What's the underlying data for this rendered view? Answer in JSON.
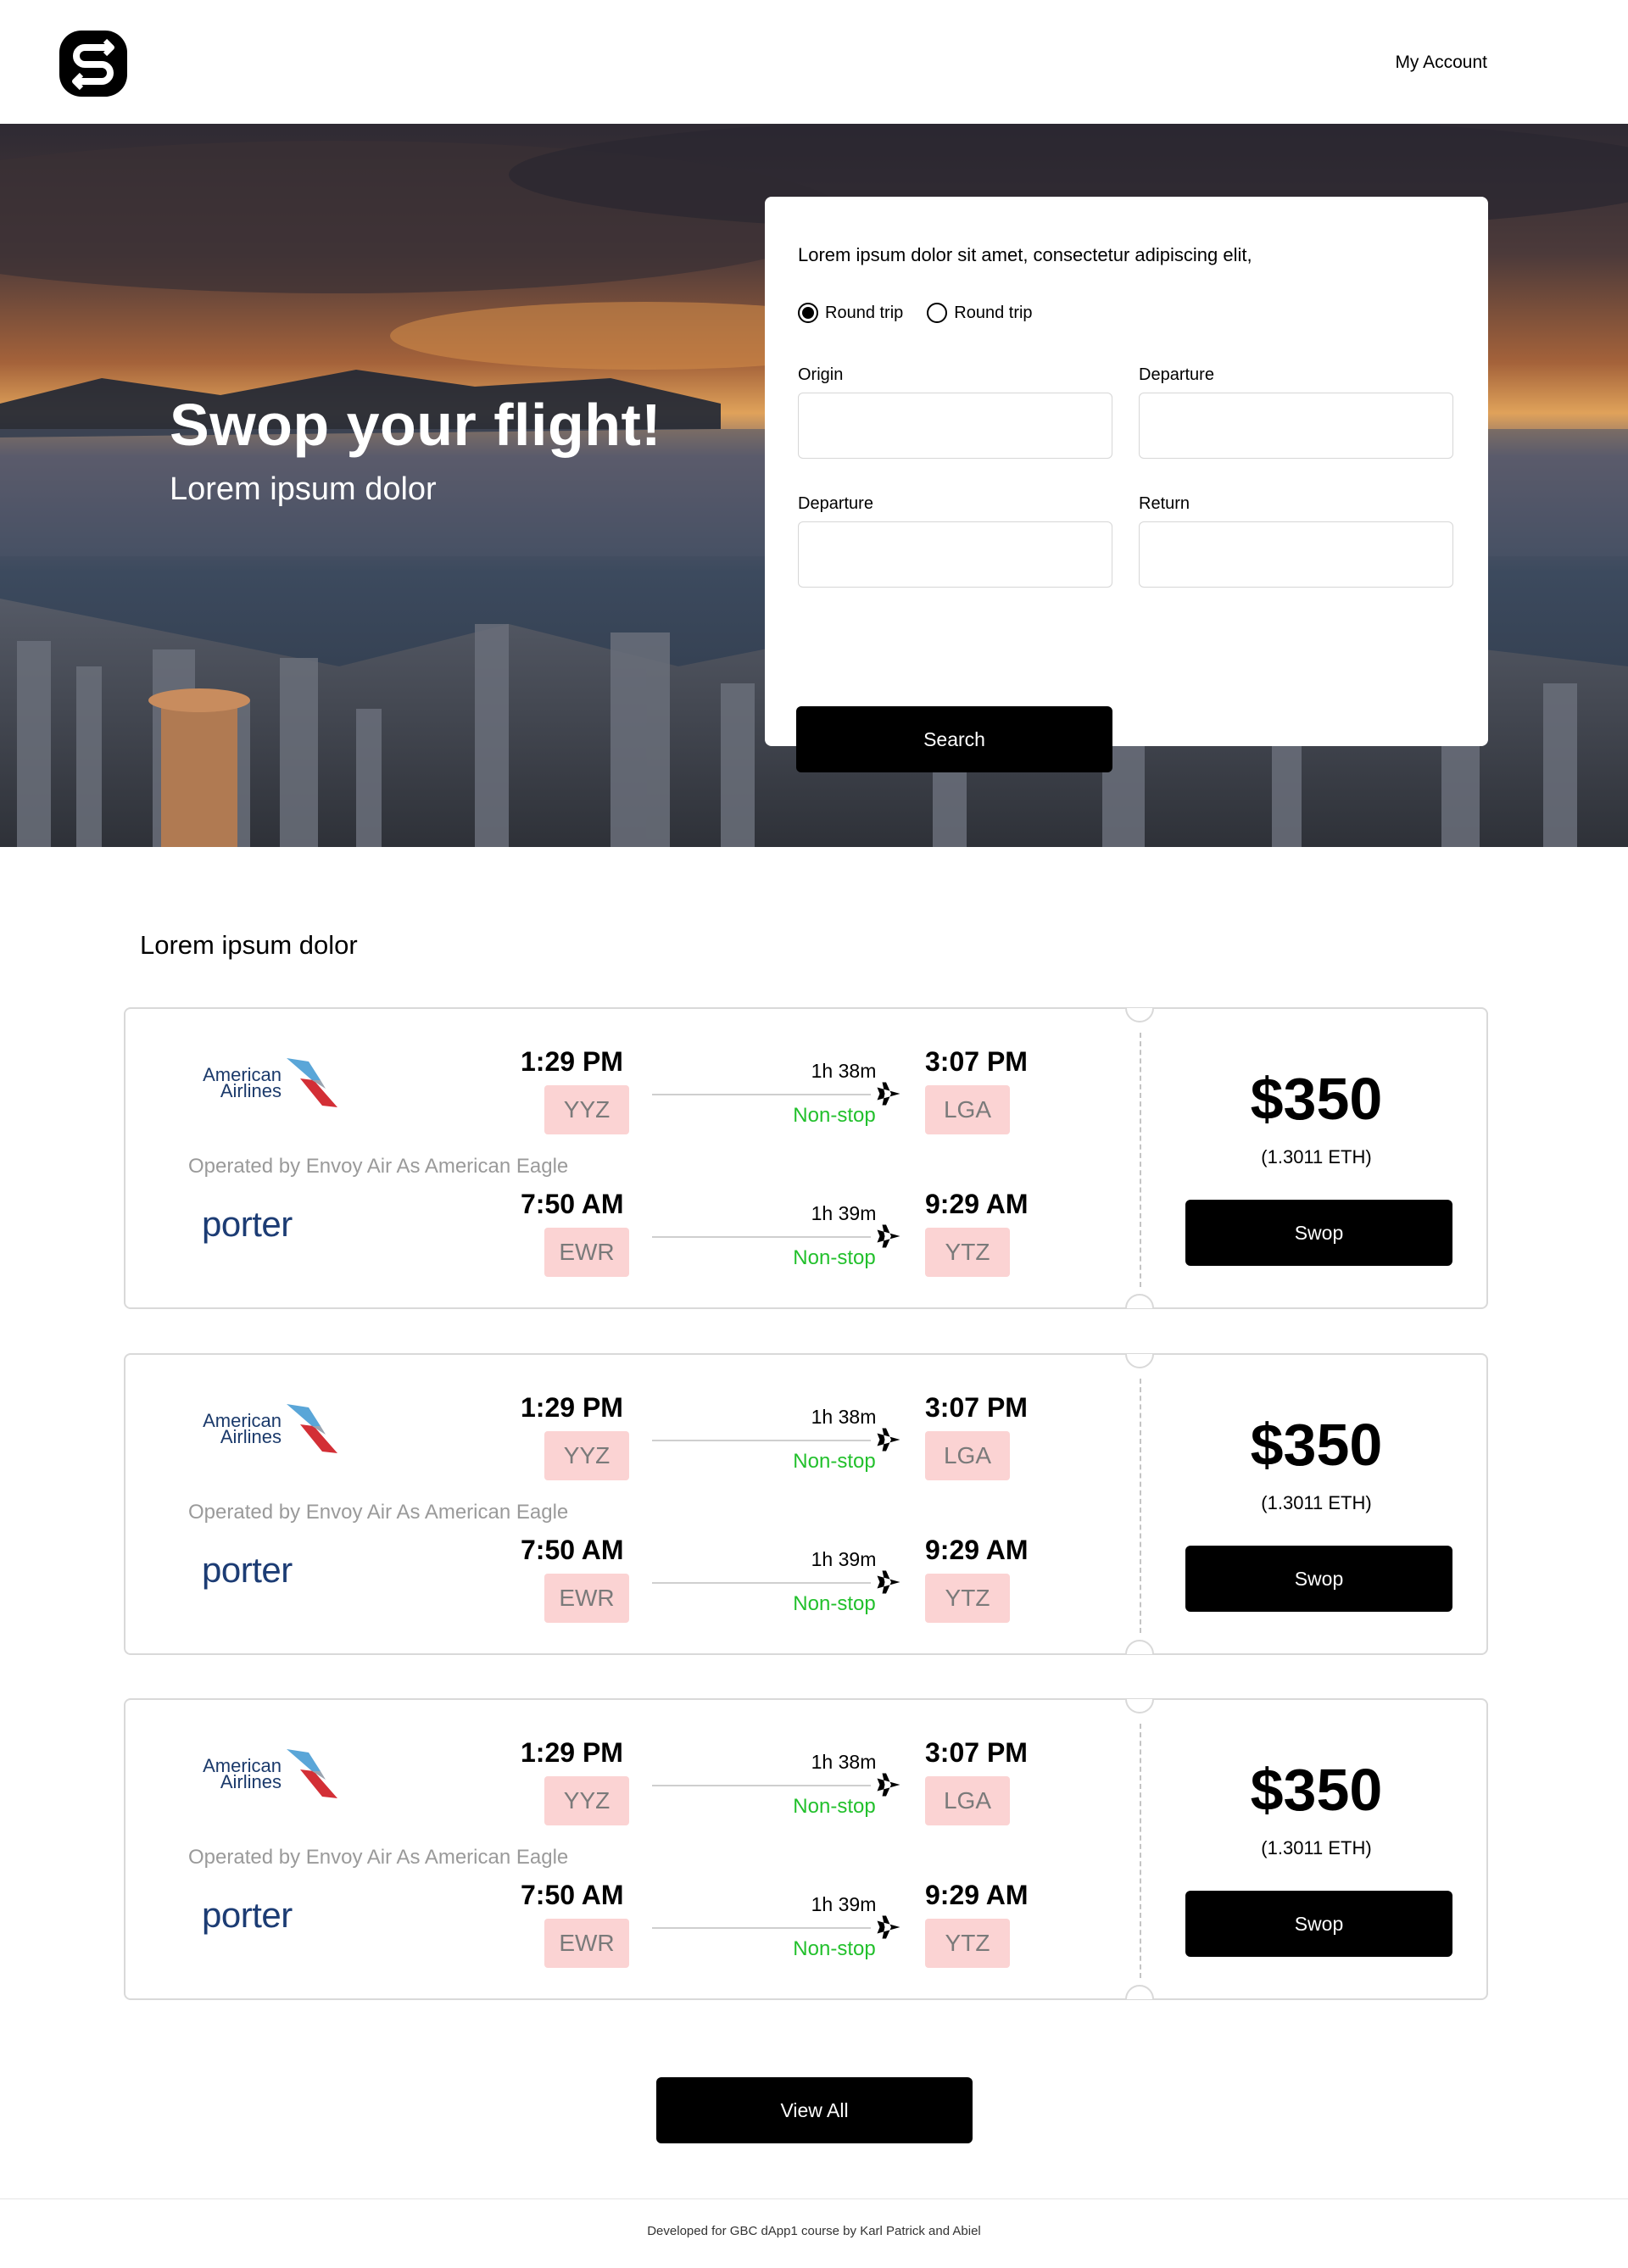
{
  "header": {
    "my_account": "My Account"
  },
  "hero": {
    "title": "Swop your flight!",
    "subtitle": "Lorem ipsum dolor"
  },
  "search": {
    "lead": "Lorem ipsum dolor sit amet, consectetur adipiscing elit,",
    "trip_options": [
      {
        "label": "Round trip",
        "selected": true
      },
      {
        "label": "Round trip",
        "selected": false
      }
    ],
    "fields": {
      "origin_label": "Origin",
      "origin_value": "",
      "departure_label": "Departure",
      "departure_value": "",
      "departure2_label": "Departure",
      "departure2_value": "",
      "return_label": "Return",
      "return_value": ""
    },
    "button": "Search"
  },
  "section_title": "Lorem ipsum dolor",
  "tickets": [
    {
      "airline1": "American Airlines",
      "operated_by": "Operated by Envoy Air As American Eagle",
      "airline2": "porter",
      "leg1": {
        "depart_time": "1:29 PM",
        "depart_code": "YYZ",
        "duration": "1h 38m",
        "stops": "Non-stop",
        "arrive_time": "3:07 PM",
        "arrive_code": "LGA"
      },
      "leg2": {
        "depart_time": "7:50 AM",
        "depart_code": "EWR",
        "duration": "1h 39m",
        "stops": "Non-stop",
        "arrive_time": "9:29 AM",
        "arrive_code": "YTZ"
      },
      "price": "$350",
      "eth": "(1.3011 ETH)",
      "button": "Swop"
    },
    {
      "airline1": "American Airlines",
      "operated_by": "Operated by Envoy Air As American Eagle",
      "airline2": "porter",
      "leg1": {
        "depart_time": "1:29 PM",
        "depart_code": "YYZ",
        "duration": "1h 38m",
        "stops": "Non-stop",
        "arrive_time": "3:07 PM",
        "arrive_code": "LGA"
      },
      "leg2": {
        "depart_time": "7:50 AM",
        "depart_code": "EWR",
        "duration": "1h 39m",
        "stops": "Non-stop",
        "arrive_time": "9:29 AM",
        "arrive_code": "YTZ"
      },
      "price": "$350",
      "eth": "(1.3011 ETH)",
      "button": "Swop"
    },
    {
      "airline1": "American Airlines",
      "operated_by": "Operated by Envoy Air As American Eagle",
      "airline2": "porter",
      "leg1": {
        "depart_time": "1:29 PM",
        "depart_code": "YYZ",
        "duration": "1h 38m",
        "stops": "Non-stop",
        "arrive_time": "3:07 PM",
        "arrive_code": "LGA"
      },
      "leg2": {
        "depart_time": "7:50 AM",
        "depart_code": "EWR",
        "duration": "1h 39m",
        "stops": "Non-stop",
        "arrive_time": "9:29 AM",
        "arrive_code": "YTZ"
      },
      "price": "$350",
      "eth": "(1.3011 ETH)",
      "button": "Swop"
    }
  ],
  "view_all": "View All",
  "footer": "Developed for GBC dApp1 course by Karl Patrick and Abiel",
  "colors": {
    "accent": "#000000",
    "code_bg": "#fbd3d3",
    "nonstop": "#22c02c",
    "porter": "#1c3c74"
  }
}
